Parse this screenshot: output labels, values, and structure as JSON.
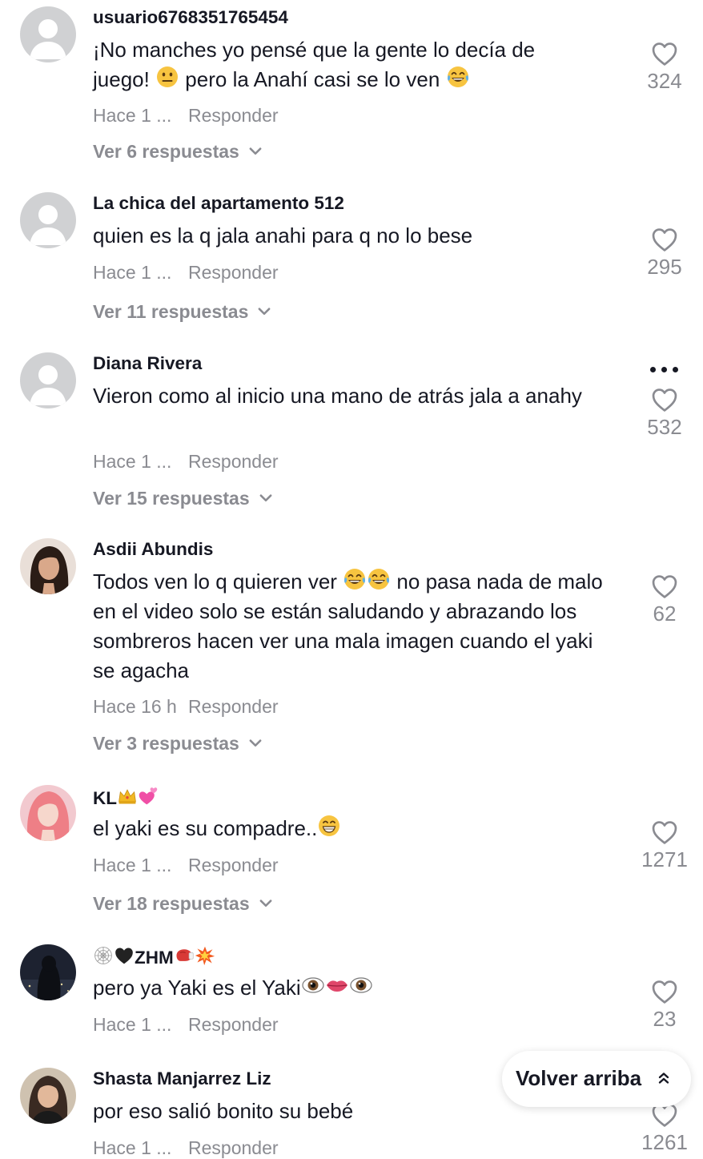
{
  "comments": [
    {
      "username": "usuario6768351765454",
      "text": "¡No manches yo pensé que la gente lo decía de juego! 😐 pero la Anahí casi se lo ven 😂",
      "text_parts": [
        "¡No manches yo pensé que la gente lo decía de",
        "juego! ",
        " pero la Anahí casi se lo ven "
      ],
      "time": "Hace 1 ...",
      "reply_label": "Responder",
      "view_replies": "Ver 6 respuestas",
      "likes": "324"
    },
    {
      "username": "La chica del apartamento 512",
      "text": "quien es la q jala anahi para q no lo bese",
      "time": "Hace 1 ...",
      "reply_label": "Responder",
      "view_replies": "Ver 11 respuestas",
      "likes": "295"
    },
    {
      "username": "Diana Rivera",
      "text": "Vieron como al inicio una mano de atrás jala a anahy",
      "time": "Hace 1 ...",
      "reply_label": "Responder",
      "view_replies": "Ver 15 respuestas",
      "likes": "532"
    },
    {
      "username": "Asdii Abundis",
      "text": "Todos ven lo q quieren ver 😂😂 no pasa nada de malo en el video solo se están saludando y abrazando los sombreros hacen ver una mala imagen cuando el yaki se agacha",
      "text_parts": [
        "Todos ven lo q quieren ver ",
        " no pasa nada de malo en el video solo se están saludando y abrazando los sombreros hacen ver una mala imagen cuando el yaki se agacha"
      ],
      "time": "Hace 16 h",
      "reply_label": "Responder",
      "view_replies": "Ver 3 respuestas",
      "likes": "62"
    },
    {
      "username": "KL👑💕",
      "username_text": "KL",
      "text": "el yaki es su compadre..😁",
      "text_plain": "el yaki es su compadre..",
      "time": "Hace 1 ...",
      "reply_label": "Responder",
      "view_replies": "Ver 18 respuestas",
      "likes": "1271"
    },
    {
      "username": "🕸🖤ZHM🥊💥",
      "username_text": "ZHM",
      "text": "pero ya Yaki es el Yaki👁👄👁",
      "text_plain": "pero ya Yaki es el Yaki",
      "time": "Hace 1 ...",
      "reply_label": "Responder",
      "likes": "23"
    },
    {
      "username": "Shasta Manjarrez Liz",
      "text": "por eso salió bonito su bebé",
      "time": "Hace 1 ...",
      "reply_label": "Responder",
      "likes": "1261"
    }
  ],
  "back_to_top": "Volver arriba",
  "icons": {
    "like": "heart-outline-icon",
    "expand": "chevron-down-icon",
    "more": "more-options-icon",
    "back_to_top": "double-chevron-up-icon",
    "default_avatar": "default-avatar-icon"
  },
  "colors": {
    "text": "#161823",
    "secondary": "#8a8b91",
    "avatar_placeholder": "#d0d1d3"
  }
}
